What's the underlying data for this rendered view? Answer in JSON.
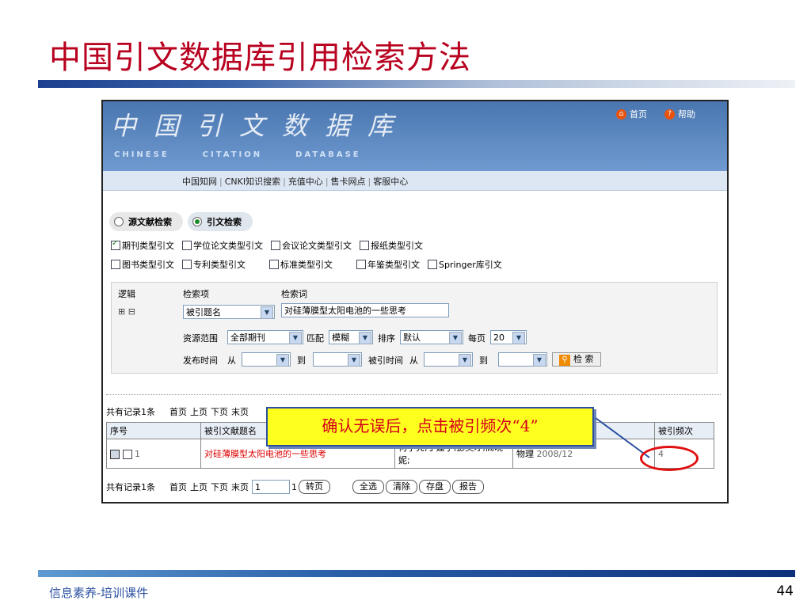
{
  "slide": {
    "title": "中国引文数据库引用检索方法",
    "footer": "信息素养-培训课件",
    "page_number": "44",
    "accent_color": "#b8001f"
  },
  "app": {
    "banner_cn": "中国引文数据库",
    "banner_en": [
      "CHINESE",
      "CITATION",
      "DATABASE"
    ],
    "top_links": [
      {
        "label": "首页",
        "icon": "home-icon"
      },
      {
        "label": "帮助",
        "icon": "help-icon"
      }
    ],
    "nav_links": [
      "中国知网",
      "CNKI知识搜索",
      "充值中心",
      "售卡网点",
      "客服中心"
    ]
  },
  "tabs": [
    {
      "label": "源文献检索",
      "selected": false
    },
    {
      "label": "引文检索",
      "selected": true
    }
  ],
  "type_checkboxes_row1": [
    {
      "label": "期刊类型引文",
      "checked": true
    },
    {
      "label": "学位论文类型引文",
      "checked": false
    },
    {
      "label": "会议论文类型引文",
      "checked": false
    },
    {
      "label": "报纸类型引文",
      "checked": false
    }
  ],
  "type_checkboxes_row2": [
    {
      "label": "图书类型引文",
      "checked": false
    },
    {
      "label": "专利类型引文",
      "checked": false
    },
    {
      "label": "标准类型引文",
      "checked": false
    },
    {
      "label": "年鉴类型引文",
      "checked": false
    },
    {
      "label": "Springer库引文",
      "checked": false
    }
  ],
  "search": {
    "col_logic": "逻辑",
    "col_field": "检索项",
    "col_term": "检索词",
    "expand_icons": "⊞ ⊟",
    "field_value": "被引题名",
    "term_value": "对硅薄膜型太阳电池的一些思考",
    "scope_label": "资源范围",
    "scope_value": "全部期刊",
    "match_label": "匹配",
    "match_value": "模糊",
    "sort_label": "排序",
    "sort_value": "默认",
    "per_page_label": "每页",
    "per_page_value": "20",
    "pubtime_label": "发布时间",
    "from_label": "从",
    "to_label": "到",
    "cited_time_label": "被引时间",
    "search_button": "检 索"
  },
  "pager": {
    "total": "共有记录1条",
    "first": "首页",
    "prev": "上页",
    "next": "下页",
    "last": "末页",
    "page_value": "1",
    "page_count": "1",
    "go": "转页",
    "select_all": "全选",
    "clear": "清除",
    "save": "存盘",
    "report": "报告"
  },
  "results": {
    "headers": [
      "序号",
      "被引文献题名",
      "",
      "",
      "被引频次"
    ],
    "rows": [
      {
        "no": "1",
        "title": "对硅薄膜型太阳电池的一些思考",
        "authors": "何宇亮;丁建宁;彭英才;高晓妮;",
        "source": "物理",
        "year": "2008/12",
        "cited": "4"
      }
    ]
  },
  "callout": "确认无误后，点击被引频次“4”"
}
